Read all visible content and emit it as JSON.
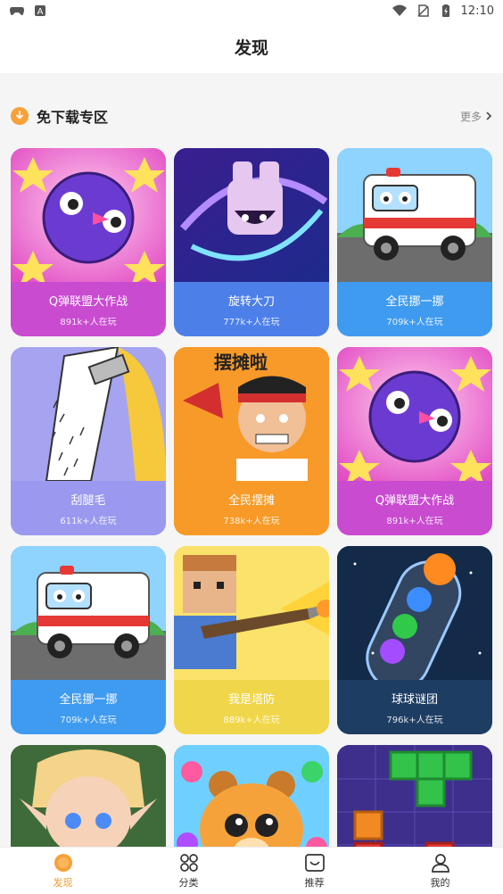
{
  "status_bar": {
    "time": "12:10"
  },
  "header": {
    "title": "发现"
  },
  "section": {
    "title": "免下载专区",
    "more_label": "更多"
  },
  "games": [
    {
      "title": "Q弹联盟大作战",
      "plays": "891k+人在玩",
      "art": "purple-ball",
      "label_color": "#c94bd0"
    },
    {
      "title": "旋转大刀",
      "plays": "777k+人在玩",
      "art": "blade-robot",
      "label_color": "#4d7fe8"
    },
    {
      "title": "全民挪一挪",
      "plays": "709k+人在玩",
      "art": "ambulance",
      "label_color": "#3f9bf0"
    },
    {
      "title": "刮腿毛",
      "plays": "611k+人在玩",
      "art": "leg-shave",
      "label_color": "#9b99ef"
    },
    {
      "title": "全民摆摊",
      "plays": "738k+人在玩",
      "art": "vendor-man",
      "label_color": "#f79a27"
    },
    {
      "title": "Q弹联盟大作战",
      "plays": "891k+人在玩",
      "art": "purple-ball",
      "label_color": "#c94bd0"
    },
    {
      "title": "全民挪一挪",
      "plays": "709k+人在玩",
      "art": "ambulance",
      "label_color": "#3f9bf0"
    },
    {
      "title": "我是塔防",
      "plays": "889k+人在玩",
      "art": "blocky-gunner",
      "label_color": "#f0d64a"
    },
    {
      "title": "球球谜团",
      "plays": "796k+人在玩",
      "art": "ball-tube",
      "label_color": "#1e3d63"
    },
    {
      "title": "",
      "plays": "",
      "art": "elf-warrior",
      "label_color": "#3f6b3a"
    },
    {
      "title": "",
      "plays": "",
      "art": "bear-bubbles",
      "label_color": "#f9a93a"
    },
    {
      "title": "",
      "plays": "",
      "art": "block-puzzle",
      "label_color": "#3e2f8c"
    }
  ],
  "tabbar": {
    "tabs": [
      {
        "label": "发现",
        "icon": "discover-icon"
      },
      {
        "label": "分类",
        "icon": "category-icon"
      },
      {
        "label": "推荐",
        "icon": "recommend-icon"
      },
      {
        "label": "我的",
        "icon": "profile-icon"
      }
    ],
    "active_index": 0,
    "active_color": "#f29b25"
  },
  "colors": {
    "accent": "#f29b25",
    "section_icon": "#f6a13a"
  }
}
